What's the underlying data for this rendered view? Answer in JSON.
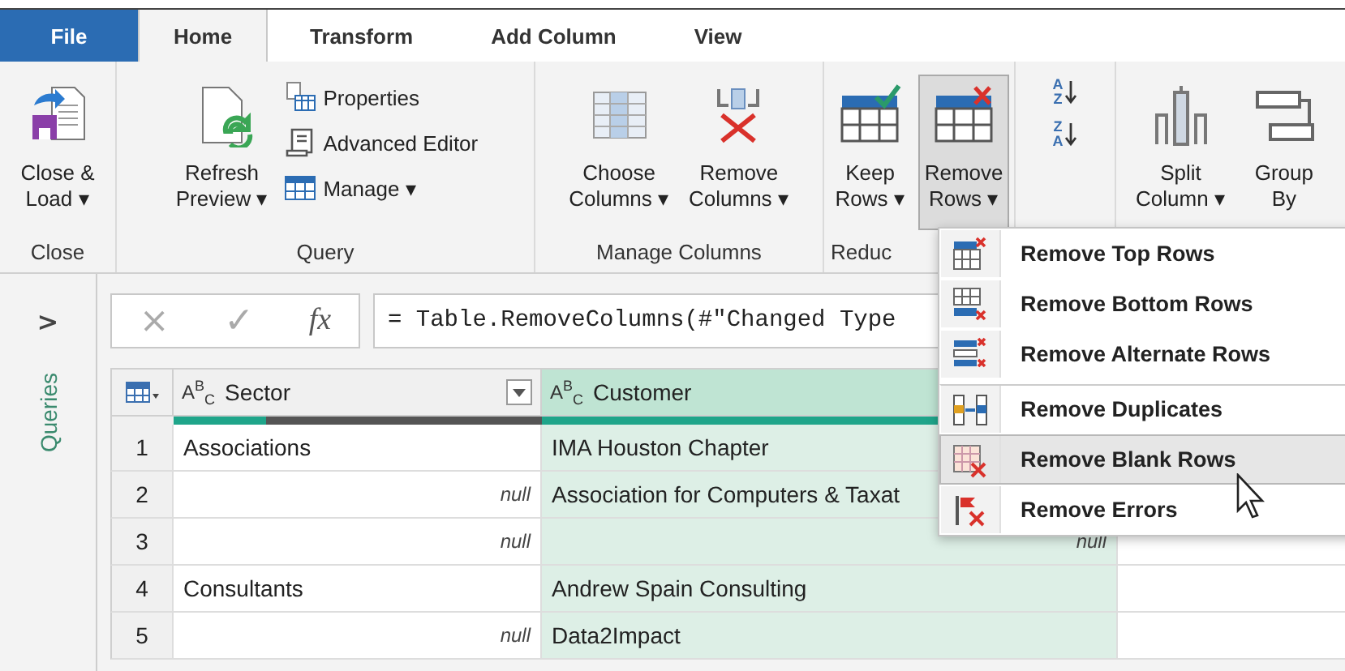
{
  "tabs": [
    {
      "label": "File",
      "kind": "file",
      "selected": false
    },
    {
      "label": "Home",
      "kind": "tab",
      "selected": true
    },
    {
      "label": "Transform",
      "kind": "tab",
      "selected": false
    },
    {
      "label": "Add Column",
      "kind": "tab",
      "selected": false
    },
    {
      "label": "View",
      "kind": "tab",
      "selected": false
    }
  ],
  "ribbon": {
    "groups": [
      {
        "label": "Close",
        "items": [
          {
            "kind": "large",
            "lines": [
              "Close &",
              "Load ▾"
            ],
            "pressed": false
          }
        ]
      },
      {
        "label": "Query",
        "items": [
          {
            "kind": "large",
            "lines": [
              "Refresh",
              "Preview ▾"
            ],
            "pressed": false
          },
          {
            "kind": "stack",
            "buttons": [
              {
                "label": "Properties"
              },
              {
                "label": "Advanced Editor"
              },
              {
                "label": "Manage ▾"
              }
            ]
          }
        ]
      },
      {
        "label": "Manage Columns",
        "items": [
          {
            "kind": "large",
            "lines": [
              "Choose",
              "Columns ▾"
            ],
            "pressed": false
          },
          {
            "kind": "large",
            "lines": [
              "Remove",
              "Columns ▾"
            ],
            "pressed": false
          }
        ]
      },
      {
        "label": "Reduc",
        "items": [
          {
            "kind": "large",
            "lines": [
              "Keep",
              "Rows ▾"
            ],
            "pressed": false
          },
          {
            "kind": "large",
            "lines": [
              "Remove",
              "Rows ▾"
            ],
            "pressed": true
          }
        ]
      },
      {
        "items": [
          {
            "kind": "sort",
            "buttons": [
              {
                "top": "A",
                "bottom": "Z"
              },
              {
                "top": "Z",
                "bottom": "A"
              }
            ]
          }
        ]
      },
      {
        "items": [
          {
            "kind": "large",
            "lines": [
              "Split",
              "Column ▾"
            ],
            "pressed": false
          },
          {
            "kind": "large",
            "lines": [
              "Group",
              "By"
            ],
            "pressed": false
          }
        ]
      }
    ]
  },
  "sidebar": {
    "toggle": ">",
    "title": "Queries"
  },
  "formula_bar": {
    "cancel": "×",
    "confirm": "✓",
    "fx": "fx",
    "formula": "= Table.RemoveColumns(#\"Changed Type"
  },
  "table": {
    "columns": [
      {
        "type_label": "A$^{B}$$_{C}$",
        "name": "Sector",
        "selected": false,
        "level": 0.25
      },
      {
        "type_label": "A$^{B}$$_{C}$",
        "name": "Customer",
        "selected": true,
        "level": 1
      }
    ],
    "rows": [
      {
        "index": "1",
        "cells": [
          {
            "kind": "text",
            "text": "Associations"
          },
          {
            "kind": "text",
            "text": "IMA Houston Chapter"
          }
        ]
      },
      {
        "index": "2",
        "cells": [
          {
            "kind": "null",
            "text": "null"
          },
          {
            "kind": "text",
            "text": "Association for Computers & Taxat"
          }
        ]
      },
      {
        "index": "3",
        "cells": [
          {
            "kind": "null",
            "text": "null"
          },
          {
            "kind": "null",
            "text": "null"
          }
        ]
      },
      {
        "index": "4",
        "cells": [
          {
            "kind": "text",
            "text": "Consultants"
          },
          {
            "kind": "text",
            "text": "Andrew Spain Consulting"
          }
        ]
      },
      {
        "index": "5",
        "cells": [
          {
            "kind": "null",
            "text": "null"
          },
          {
            "kind": "text",
            "text": "Data2Impact"
          }
        ]
      }
    ]
  },
  "remove_rows_menu": {
    "items": [
      {
        "label": "Remove Top Rows",
        "highlighted": false,
        "separator_before": false
      },
      {
        "label": "Remove Bottom Rows",
        "highlighted": false,
        "separator_before": false
      },
      {
        "label": "Remove Alternate Rows",
        "highlighted": false,
        "separator_before": false
      },
      {
        "label": "Remove Duplicates",
        "highlighted": false,
        "separator_before": true
      },
      {
        "label": "Remove Blank Rows",
        "highlighted": true,
        "separator_before": false
      },
      {
        "label": "Remove Errors",
        "highlighted": false,
        "separator_before": false
      }
    ]
  }
}
